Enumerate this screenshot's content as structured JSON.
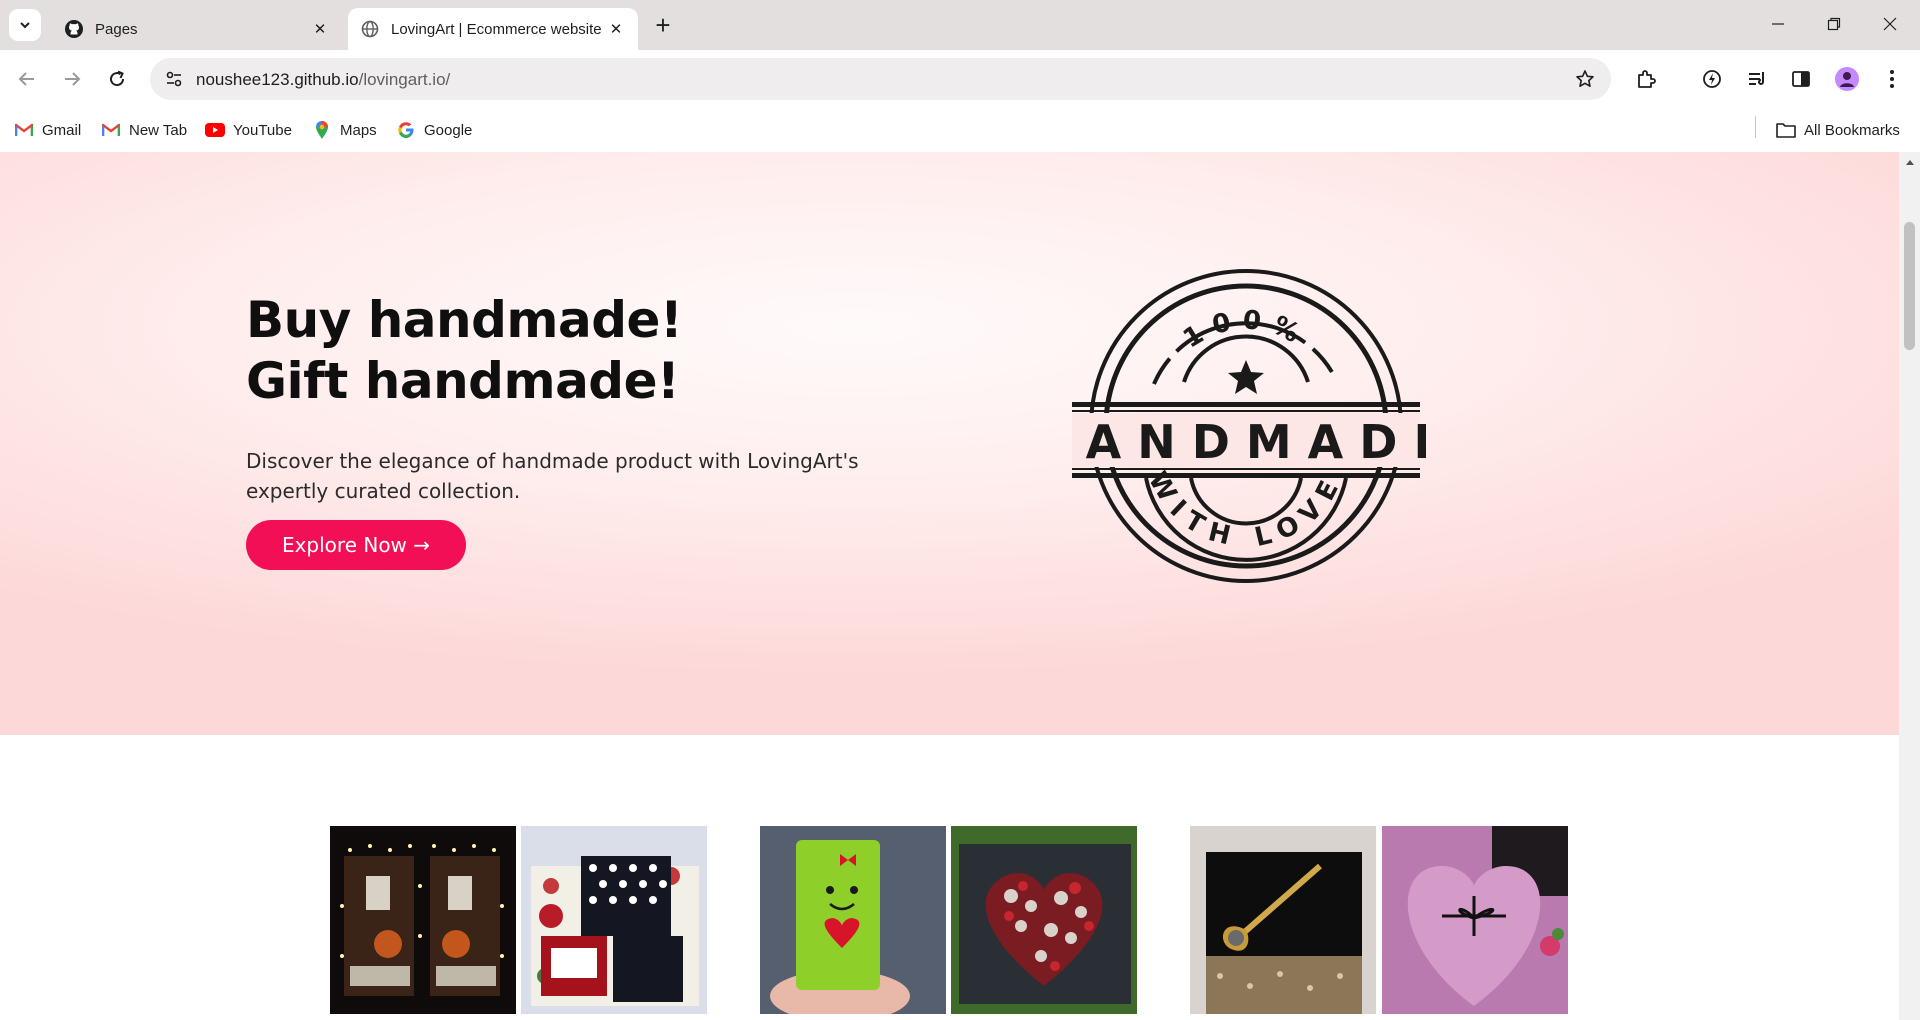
{
  "browser": {
    "tabs": [
      {
        "title": "Pages",
        "favicon": "github-icon"
      },
      {
        "title": "LovingArt | Ecommerce website",
        "favicon": "globe-icon",
        "active": true
      }
    ],
    "url_host": "noushee123.github.io",
    "url_path": "/lovingart.io/",
    "bookmarks": [
      {
        "label": "Gmail",
        "icon": "gmail-icon"
      },
      {
        "label": "New Tab",
        "icon": "gmail-icon"
      },
      {
        "label": "YouTube",
        "icon": "youtube-icon"
      },
      {
        "label": "Maps",
        "icon": "maps-icon"
      },
      {
        "label": "Google",
        "icon": "google-icon"
      }
    ],
    "all_bookmarks_label": "All Bookmarks"
  },
  "hero": {
    "title_line1": "Buy handmade!",
    "title_line2": "Gift handmade!",
    "description": "Discover the elegance of handmade product with LovingArt's expertly curated collection.",
    "cta_label": "Explore Now →",
    "stamp": {
      "top": "100%",
      "middle": "HANDMADE",
      "bottom": "WITH LOVE"
    }
  },
  "colors": {
    "accent": "#f20f55",
    "hero_bg": "#fdd8d8",
    "tab_strip": "#e3dfdf"
  },
  "products": [
    {
      "name": "light-box-gift",
      "icon": "photo-thumbnail"
    },
    {
      "name": "polka-dot-gift-box",
      "icon": "photo-thumbnail"
    },
    {
      "name": "chocolate-wrap-heart",
      "icon": "photo-thumbnail"
    },
    {
      "name": "button-heart-art",
      "icon": "photo-thumbnail"
    },
    {
      "name": "black-box-key",
      "icon": "photo-thumbnail"
    },
    {
      "name": "pink-heart-box",
      "icon": "photo-thumbnail"
    }
  ]
}
